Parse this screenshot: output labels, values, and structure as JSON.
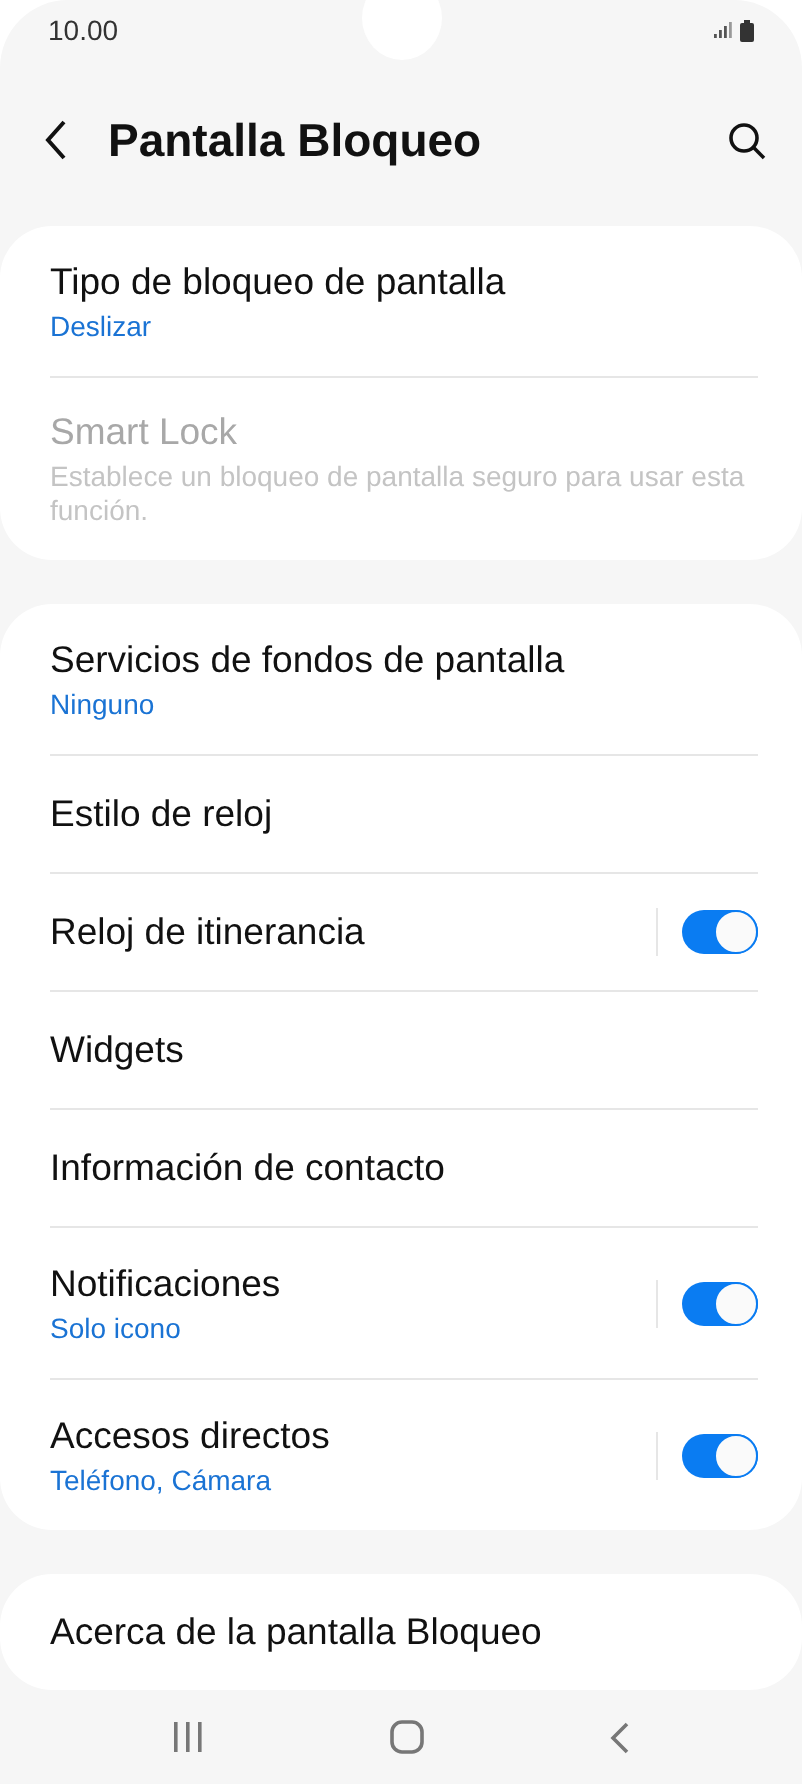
{
  "status_bar": {
    "time": "10.00"
  },
  "header": {
    "title": "Pantalla Bloqueo"
  },
  "sections": [
    {
      "items": [
        {
          "kind": "plain",
          "title": "Tipo de bloqueo de pantalla",
          "subtitle": "Deslizar",
          "disabled": false
        },
        {
          "kind": "plain",
          "title": "Smart Lock",
          "subtitle": "Establece un bloqueo de pantalla seguro para usar esta función.",
          "disabled": true
        }
      ]
    },
    {
      "items": [
        {
          "kind": "plain",
          "title": "Servicios de fondos de pantalla",
          "subtitle": "Ninguno",
          "disabled": false
        },
        {
          "kind": "plain",
          "title": "Estilo de reloj",
          "disabled": false
        },
        {
          "kind": "toggle",
          "title": "Reloj de itinerancia",
          "disabled": false,
          "on": true
        },
        {
          "kind": "plain",
          "title": "Widgets",
          "disabled": false
        },
        {
          "kind": "plain",
          "title": "Información de contacto",
          "disabled": false
        },
        {
          "kind": "toggle",
          "title": "Notificaciones",
          "subtitle": "Solo icono",
          "disabled": false,
          "on": true
        },
        {
          "kind": "toggle",
          "title": "Accesos directos",
          "subtitle": "Teléfono, Cámara",
          "disabled": false,
          "on": true
        }
      ]
    },
    {
      "items": [
        {
          "kind": "plain",
          "title": "Acerca de la pantalla Bloqueo",
          "disabled": false
        }
      ]
    }
  ]
}
